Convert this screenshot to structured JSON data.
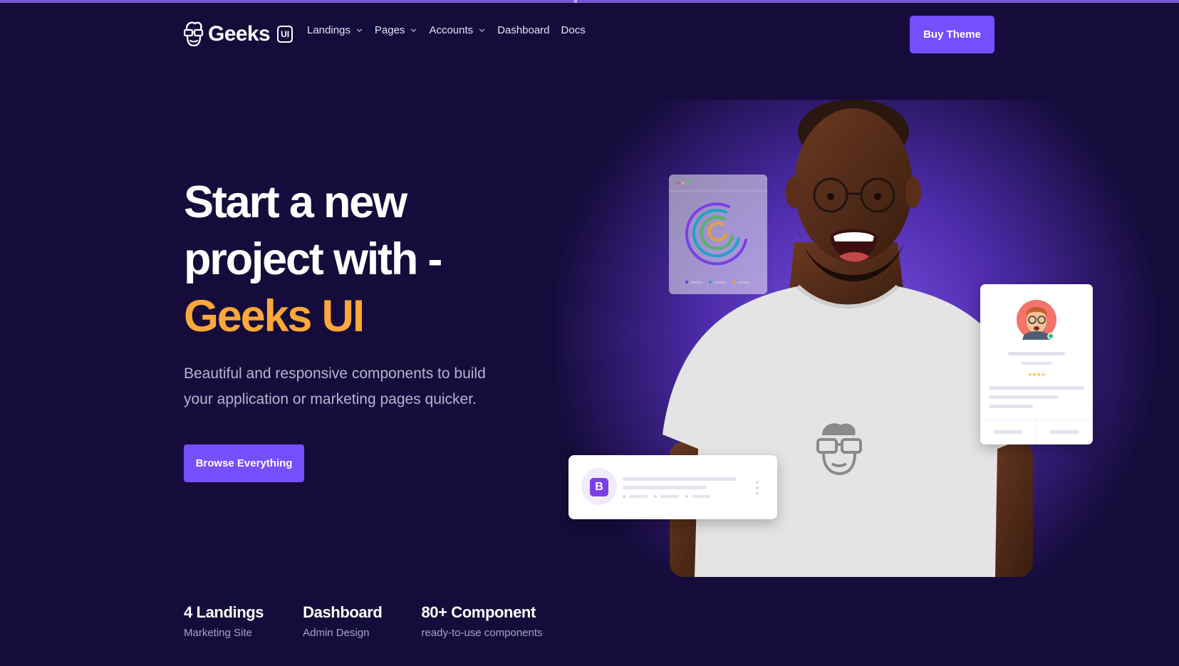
{
  "nav": {
    "brand": {
      "name": "Geeks",
      "badge": "UI"
    },
    "items": [
      {
        "label": "Landings",
        "dropdown": true
      },
      {
        "label": "Pages",
        "dropdown": true
      },
      {
        "label": "Accounts",
        "dropdown": true
      },
      {
        "label": "Dashboard",
        "dropdown": false
      },
      {
        "label": "Docs",
        "dropdown": false
      }
    ],
    "cta": "Buy Theme"
  },
  "hero": {
    "title_line1": "Start a new",
    "title_line2": "project with -",
    "title_highlight": "Geeks UI",
    "subtitle": "Beautiful and responsive components to build your application or marketing pages quicker.",
    "button": "Browse Everything"
  },
  "cards": {
    "list_card_icon_letter": "B",
    "profile_rating_stars": 4
  },
  "stats": [
    {
      "title": "4 Landings",
      "subtitle": "Marketing Site"
    },
    {
      "title": "Dashboard",
      "subtitle": "Admin Design"
    },
    {
      "title": "80+ Component",
      "subtitle": "ready-to-use components"
    }
  ],
  "colors": {
    "background": "#150c3b",
    "primary": "#754ffe",
    "accent": "#ffa73b",
    "text_muted": "#b9b3cf"
  },
  "icons": {
    "logo": "geek-face-icon",
    "dropdown": "chevron-down-icon",
    "bootstrap": "bootstrap-icon",
    "kebab": "more-vertical-icon"
  }
}
